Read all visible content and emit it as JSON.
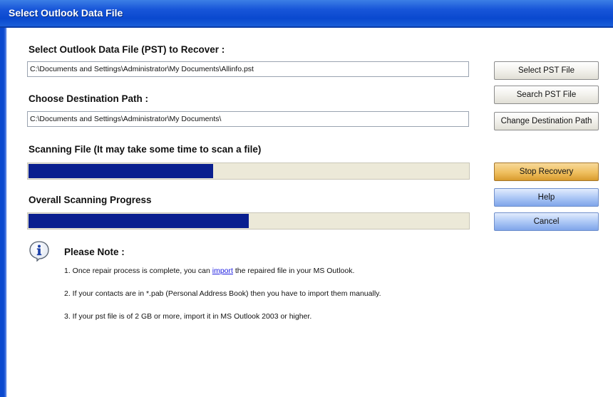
{
  "window": {
    "title": "Select Outlook Data File"
  },
  "pst": {
    "label": "Select Outlook Data File (PST) to Recover :",
    "value": "C:\\Documents and Settings\\Administrator\\My Documents\\Allinfo.pst"
  },
  "destination": {
    "label": "Choose Destination Path :",
    "value": "C:\\Documents and Settings\\Administrator\\My Documents\\"
  },
  "scan": {
    "label": "Scanning File (It may take some time to scan a file)",
    "progress": 0.42
  },
  "overall": {
    "label": "Overall Scanning Progress",
    "progress": 0.5
  },
  "buttons": {
    "select_pst": "Select PST File",
    "search_pst": "Search PST File",
    "change_dest": "Change Destination Path",
    "stop_recovery": "Stop Recovery",
    "help": "Help",
    "cancel": "Cancel"
  },
  "note": {
    "title": "Please Note :",
    "line1_pre": "1. Once repair process is complete, you can ",
    "line1_link": "import",
    "line1_post": " the repaired file in your MS Outlook.",
    "line2": "2. If your contacts are in *.pab (Personal Address Book) then you have to import them manually.",
    "line3": "3. If your pst file is of 2 GB or more, import it in MS Outlook 2003 or higher."
  },
  "colors": {
    "titlebar": "#0a49cf",
    "progress_fill": "#0a1f8f",
    "progress_track": "#ece9d8",
    "stop_button": "#efbf5f",
    "help_button": "#aec8f6"
  },
  "icons": {
    "note": "info-icon"
  }
}
